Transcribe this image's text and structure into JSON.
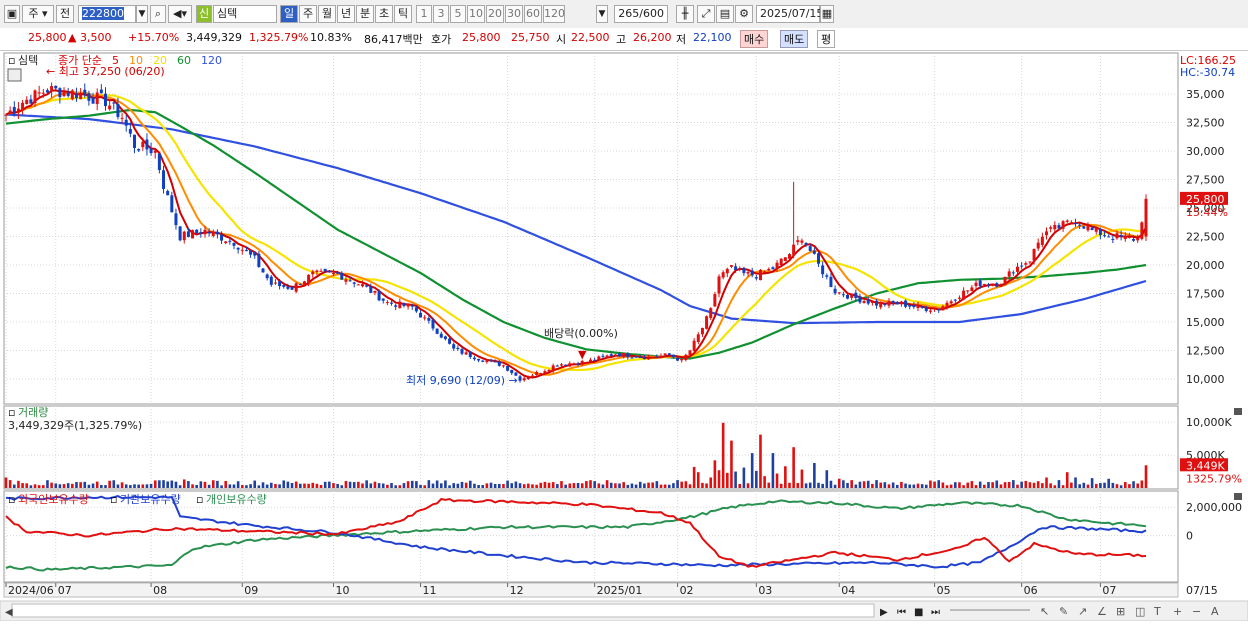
{
  "toolbar": {
    "type_label": "주",
    "prev_label": "전",
    "code": "222800",
    "stock_badge": "신",
    "stock_name": "심텍",
    "period_buttons": [
      "일",
      "주",
      "월",
      "년",
      "분",
      "초",
      "틱"
    ],
    "interval_buttons": [
      "1",
      "3",
      "5",
      "10",
      "20",
      "30",
      "60",
      "120"
    ],
    "count": "265",
    "count_total": "/600",
    "date": "2025/07/15"
  },
  "infobar": {
    "price": "25,800",
    "change": "▲ 3,500",
    "change_pct": "+15.70%",
    "volume": "3,449,329",
    "volume_pct": "1,325.79%",
    "turnover_pct": "10.83%",
    "amount": "86,417백만",
    "quote_label": "호가",
    "ask": "25,800",
    "bid": "25,750",
    "open_label": "시",
    "open": "22,500",
    "high_label": "고",
    "high": "26,200",
    "low_label": "저",
    "low": "22,100",
    "buy_label": "매수",
    "sell_label": "매도",
    "eval_label": "평"
  },
  "chart_data": {
    "type": "candlestick",
    "title": "심텍",
    "legend": {
      "prefix": "종가 단순",
      "periods": [
        {
          "label": "5",
          "color": "#e00000"
        },
        {
          "label": "10",
          "color": "#ff8c00"
        },
        {
          "label": "20",
          "color": "#f0e000"
        },
        {
          "label": "60",
          "color": "#109030"
        },
        {
          "label": "120",
          "color": "#3050e0"
        }
      ]
    },
    "price_axis": {
      "ticks": [
        "35,000",
        "32,500",
        "30,000",
        "27,500",
        "25,000",
        "22,500",
        "20,000",
        "17,500",
        "15,000",
        "12,500",
        "10,000"
      ],
      "tick_values": [
        35000,
        32500,
        30000,
        27500,
        25000,
        22500,
        20000,
        17500,
        15000,
        12500,
        10000
      ],
      "ylim": [
        8000,
        37500
      ],
      "lc_label": "LC:166.25",
      "hc_label": "HC:-30.74",
      "current_label": "25,800",
      "current_pct_label": "15.44%",
      "current_value": 25800
    },
    "annotations": {
      "high": "최고 37,250 (06/20)",
      "low": "최저 9,690 (12/09)",
      "dividend": "배당락(0.00%)"
    },
    "x_axis": {
      "ticks": [
        "2024/06",
        "07",
        "08",
        "09",
        "10",
        "11",
        "12",
        "2025/01",
        "02",
        "03",
        "04",
        "05",
        "06",
        "07"
      ],
      "tick_index": [
        0,
        12,
        35,
        57,
        79,
        100,
        121,
        142,
        162,
        181,
        201,
        224,
        245,
        264
      ],
      "end_label": "07/15",
      "n": 276
    },
    "close_anchors": [
      [
        0,
        33200
      ],
      [
        4,
        34300
      ],
      [
        10,
        35400
      ],
      [
        18,
        35000
      ],
      [
        24,
        34400
      ],
      [
        28,
        33000
      ],
      [
        31,
        30500
      ],
      [
        36,
        30000
      ],
      [
        38,
        27000
      ],
      [
        42,
        22500
      ],
      [
        48,
        23000
      ],
      [
        55,
        22000
      ],
      [
        60,
        20500
      ],
      [
        64,
        18300
      ],
      [
        69,
        18000
      ],
      [
        74,
        19200
      ],
      [
        80,
        19200
      ],
      [
        86,
        18200
      ],
      [
        92,
        16700
      ],
      [
        98,
        16300
      ],
      [
        104,
        14200
      ],
      [
        108,
        12600
      ],
      [
        114,
        11800
      ],
      [
        120,
        11200
      ],
      [
        124,
        10000
      ],
      [
        128,
        10500
      ],
      [
        133,
        11300
      ],
      [
        140,
        11500
      ],
      [
        147,
        12200
      ],
      [
        155,
        11900
      ],
      [
        160,
        12100
      ],
      [
        163,
        11600
      ],
      [
        165,
        12500
      ],
      [
        168,
        14500
      ],
      [
        170,
        16000
      ],
      [
        172,
        19000
      ],
      [
        175,
        19700
      ],
      [
        178,
        19200
      ],
      [
        181,
        19100
      ],
      [
        185,
        19700
      ],
      [
        189,
        21000
      ],
      [
        192,
        22500
      ],
      [
        196,
        20000
      ],
      [
        200,
        17700
      ],
      [
        205,
        17100
      ],
      [
        210,
        16600
      ],
      [
        216,
        16600
      ],
      [
        221,
        16200
      ],
      [
        225,
        16200
      ],
      [
        230,
        17400
      ],
      [
        235,
        18400
      ],
      [
        240,
        18400
      ],
      [
        243,
        19600
      ],
      [
        247,
        20500
      ],
      [
        250,
        22700
      ],
      [
        254,
        23300
      ],
      [
        258,
        24000
      ],
      [
        262,
        23000
      ],
      [
        266,
        22600
      ],
      [
        270,
        22300
      ],
      [
        273,
        22300
      ],
      [
        275,
        25800
      ]
    ],
    "ma120_anchors": [
      [
        0,
        33200
      ],
      [
        20,
        32800
      ],
      [
        40,
        31900
      ],
      [
        60,
        30400
      ],
      [
        80,
        28500
      ],
      [
        100,
        26300
      ],
      [
        120,
        23800
      ],
      [
        140,
        20700
      ],
      [
        158,
        17800
      ],
      [
        165,
        16400
      ],
      [
        175,
        15300
      ],
      [
        190,
        14900
      ],
      [
        210,
        15000
      ],
      [
        230,
        15000
      ],
      [
        245,
        15700
      ],
      [
        260,
        17000
      ],
      [
        275,
        18600
      ]
    ],
    "ma60_anchors": [
      [
        0,
        32400
      ],
      [
        10,
        32800
      ],
      [
        20,
        33100
      ],
      [
        30,
        33600
      ],
      [
        36,
        33400
      ],
      [
        40,
        32600
      ],
      [
        50,
        30500
      ],
      [
        60,
        28100
      ],
      [
        70,
        25600
      ],
      [
        80,
        23100
      ],
      [
        90,
        21200
      ],
      [
        100,
        19300
      ],
      [
        110,
        17000
      ],
      [
        120,
        15000
      ],
      [
        130,
        13600
      ],
      [
        140,
        12600
      ],
      [
        150,
        12200
      ],
      [
        160,
        11900
      ],
      [
        165,
        11800
      ],
      [
        172,
        12300
      ],
      [
        180,
        13200
      ],
      [
        190,
        14800
      ],
      [
        200,
        16200
      ],
      [
        210,
        17500
      ],
      [
        220,
        18400
      ],
      [
        230,
        18700
      ],
      [
        240,
        18800
      ],
      [
        250,
        19000
      ],
      [
        260,
        19300
      ],
      [
        268,
        19600
      ],
      [
        275,
        20000
      ]
    ],
    "volume": {
      "label": "거래량",
      "value_label": "3,449,329주(1,325.79%)",
      "ticks": [
        "10,000K",
        "5,000K"
      ],
      "tick_values": [
        10000,
        5000
      ],
      "ymax": 12000,
      "current_label": "3,449K",
      "current_pct_label": "1325.79%",
      "spikes": [
        [
          0,
          1600
        ],
        [
          1,
          1200
        ],
        [
          43,
          1300
        ],
        [
          162,
          1200
        ],
        [
          166,
          3200
        ],
        [
          167,
          2400
        ],
        [
          170,
          1600
        ],
        [
          171,
          4200
        ],
        [
          172,
          2700
        ],
        [
          173,
          9900
        ],
        [
          174,
          2300
        ],
        [
          175,
          7200
        ],
        [
          176,
          2500
        ],
        [
          178,
          3100
        ],
        [
          180,
          5300
        ],
        [
          181,
          2600
        ],
        [
          182,
          8100
        ],
        [
          183,
          1800
        ],
        [
          185,
          5300
        ],
        [
          186,
          2200
        ],
        [
          188,
          3300
        ],
        [
          190,
          6200
        ],
        [
          192,
          2800
        ],
        [
          195,
          3800
        ],
        [
          198,
          2700
        ],
        [
          201,
          1400
        ],
        [
          210,
          1200
        ],
        [
          243,
          1200
        ],
        [
          251,
          1600
        ],
        [
          256,
          2400
        ],
        [
          258,
          1600
        ],
        [
          262,
          1500
        ],
        [
          266,
          1400
        ],
        [
          275,
          3449
        ]
      ],
      "base": 800,
      "bar_color": "#2040a0",
      "up_color": "#e01010"
    },
    "holdings": {
      "labels": [
        "외국인보유수량",
        "기관보유수량",
        "개인보유수량"
      ],
      "colors": [
        "#e01010",
        "#2040d0",
        "#2a9050"
      ],
      "ticks": [
        "2,000,000",
        "0"
      ],
      "tick_values": [
        2000000,
        0
      ],
      "ylim": [
        -3200000,
        3000000
      ],
      "foreign": [
        [
          0,
          1300000
        ],
        [
          5,
          300000
        ],
        [
          20,
          0
        ],
        [
          40,
          500000
        ],
        [
          60,
          300000
        ],
        [
          80,
          100000
        ],
        [
          95,
          1000000
        ],
        [
          105,
          2500000
        ],
        [
          120,
          2400000
        ],
        [
          140,
          2200000
        ],
        [
          158,
          1600000
        ],
        [
          165,
          900000
        ],
        [
          172,
          -1500000
        ],
        [
          180,
          -2200000
        ],
        [
          190,
          -1700000
        ],
        [
          200,
          -1200000
        ],
        [
          215,
          -1700000
        ],
        [
          230,
          -900000
        ],
        [
          236,
          -100000
        ],
        [
          242,
          -1800000
        ],
        [
          248,
          -600000
        ],
        [
          258,
          -1300000
        ],
        [
          275,
          -1400000
        ]
      ],
      "institution": [
        [
          0,
          2600000
        ],
        [
          20,
          2700000
        ],
        [
          40,
          2700000
        ],
        [
          42,
          1300000
        ],
        [
          60,
          700000
        ],
        [
          80,
          200000
        ],
        [
          100,
          -800000
        ],
        [
          120,
          -1400000
        ],
        [
          140,
          -1900000
        ],
        [
          160,
          -2000000
        ],
        [
          170,
          -2100000
        ],
        [
          190,
          -2000000
        ],
        [
          210,
          -1900000
        ],
        [
          225,
          -2200000
        ],
        [
          235,
          -1900000
        ],
        [
          242,
          -800000
        ],
        [
          250,
          600000
        ],
        [
          260,
          500000
        ],
        [
          275,
          300000
        ]
      ],
      "individual": [
        [
          0,
          -2200000
        ],
        [
          10,
          -2400000
        ],
        [
          40,
          -2100000
        ],
        [
          45,
          -900000
        ],
        [
          60,
          -300000
        ],
        [
          90,
          200000
        ],
        [
          120,
          600000
        ],
        [
          150,
          600000
        ],
        [
          165,
          1300000
        ],
        [
          175,
          2000000
        ],
        [
          185,
          2400000
        ],
        [
          200,
          2300000
        ],
        [
          215,
          1900000
        ],
        [
          230,
          2300000
        ],
        [
          245,
          2100000
        ],
        [
          255,
          1200000
        ],
        [
          265,
          900000
        ],
        [
          275,
          700000
        ]
      ]
    }
  },
  "bottom_controls": {
    "nav": [
      "▶",
      "⏮",
      "■",
      "⏭"
    ],
    "tools": [
      "↖",
      "✎",
      "↗",
      "∠",
      "⊞",
      "◫",
      "T",
      "+",
      "−",
      "A"
    ]
  }
}
